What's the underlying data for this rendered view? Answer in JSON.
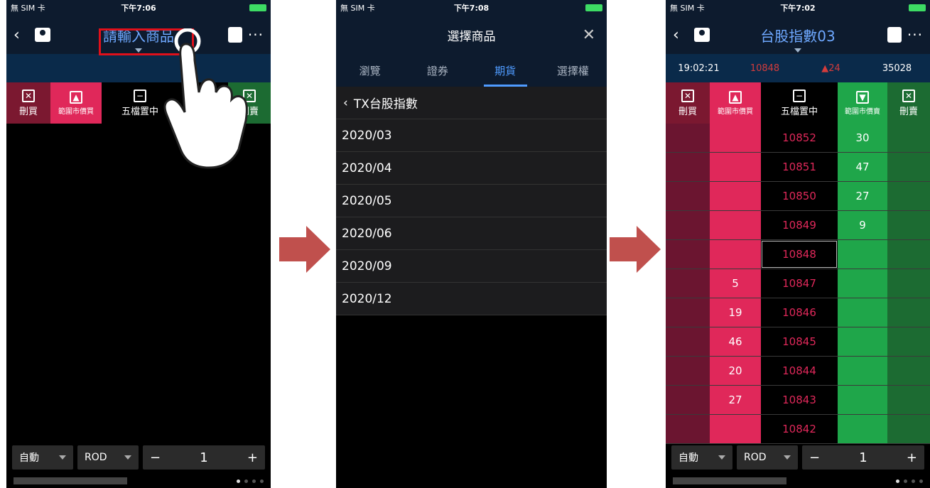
{
  "phone1": {
    "status": {
      "carrier": "無 SIM 卡",
      "time": "下午7:06"
    },
    "title": "請輸入商品",
    "actions": [
      "刪買",
      "範圍市價買",
      "五檔置中",
      "刪賣"
    ],
    "order": {
      "type": "自動",
      "tif": "ROD",
      "minus": "−",
      "qty": "1",
      "plus": "+"
    }
  },
  "phone2": {
    "status": {
      "carrier": "無 SIM 卡",
      "time": "下午7:08"
    },
    "title": "選擇商品",
    "close": "✕",
    "tabs": [
      "瀏覽",
      "證券",
      "期貨",
      "選擇權"
    ],
    "crumb": "TX台股指數",
    "months": [
      "2020/03",
      "2020/04",
      "2020/05",
      "2020/06",
      "2020/09",
      "2020/12"
    ]
  },
  "phone3": {
    "status": {
      "carrier": "無 SIM 卡",
      "time": "下午7:02"
    },
    "title": "台股指數03",
    "quote": {
      "time": "19:02:21",
      "price": "10848",
      "change": "▲24",
      "volume": "35028"
    },
    "actions": [
      "刪買",
      "範圍市價買",
      "五檔置中",
      "範圍市價賣",
      "刪賣"
    ],
    "ladder": [
      {
        "price": "10852",
        "buy": "",
        "sell": "30"
      },
      {
        "price": "10851",
        "buy": "",
        "sell": "47"
      },
      {
        "price": "10850",
        "buy": "",
        "sell": "27"
      },
      {
        "price": "10849",
        "buy": "",
        "sell": "9"
      },
      {
        "price": "10848",
        "buy": "",
        "sell": ""
      },
      {
        "price": "10847",
        "buy": "5",
        "sell": ""
      },
      {
        "price": "10846",
        "buy": "19",
        "sell": ""
      },
      {
        "price": "10845",
        "buy": "46",
        "sell": ""
      },
      {
        "price": "10844",
        "buy": "20",
        "sell": ""
      },
      {
        "price": "10843",
        "buy": "27",
        "sell": ""
      },
      {
        "price": "10842",
        "buy": "",
        "sell": ""
      }
    ],
    "order": {
      "type": "自動",
      "tif": "ROD",
      "minus": "−",
      "qty": "1",
      "plus": "+"
    }
  },
  "colors": {
    "buy": "#e0285a",
    "sell": "#1fa64a",
    "accent": "#4f9bff",
    "highlight": "#e0101a"
  }
}
